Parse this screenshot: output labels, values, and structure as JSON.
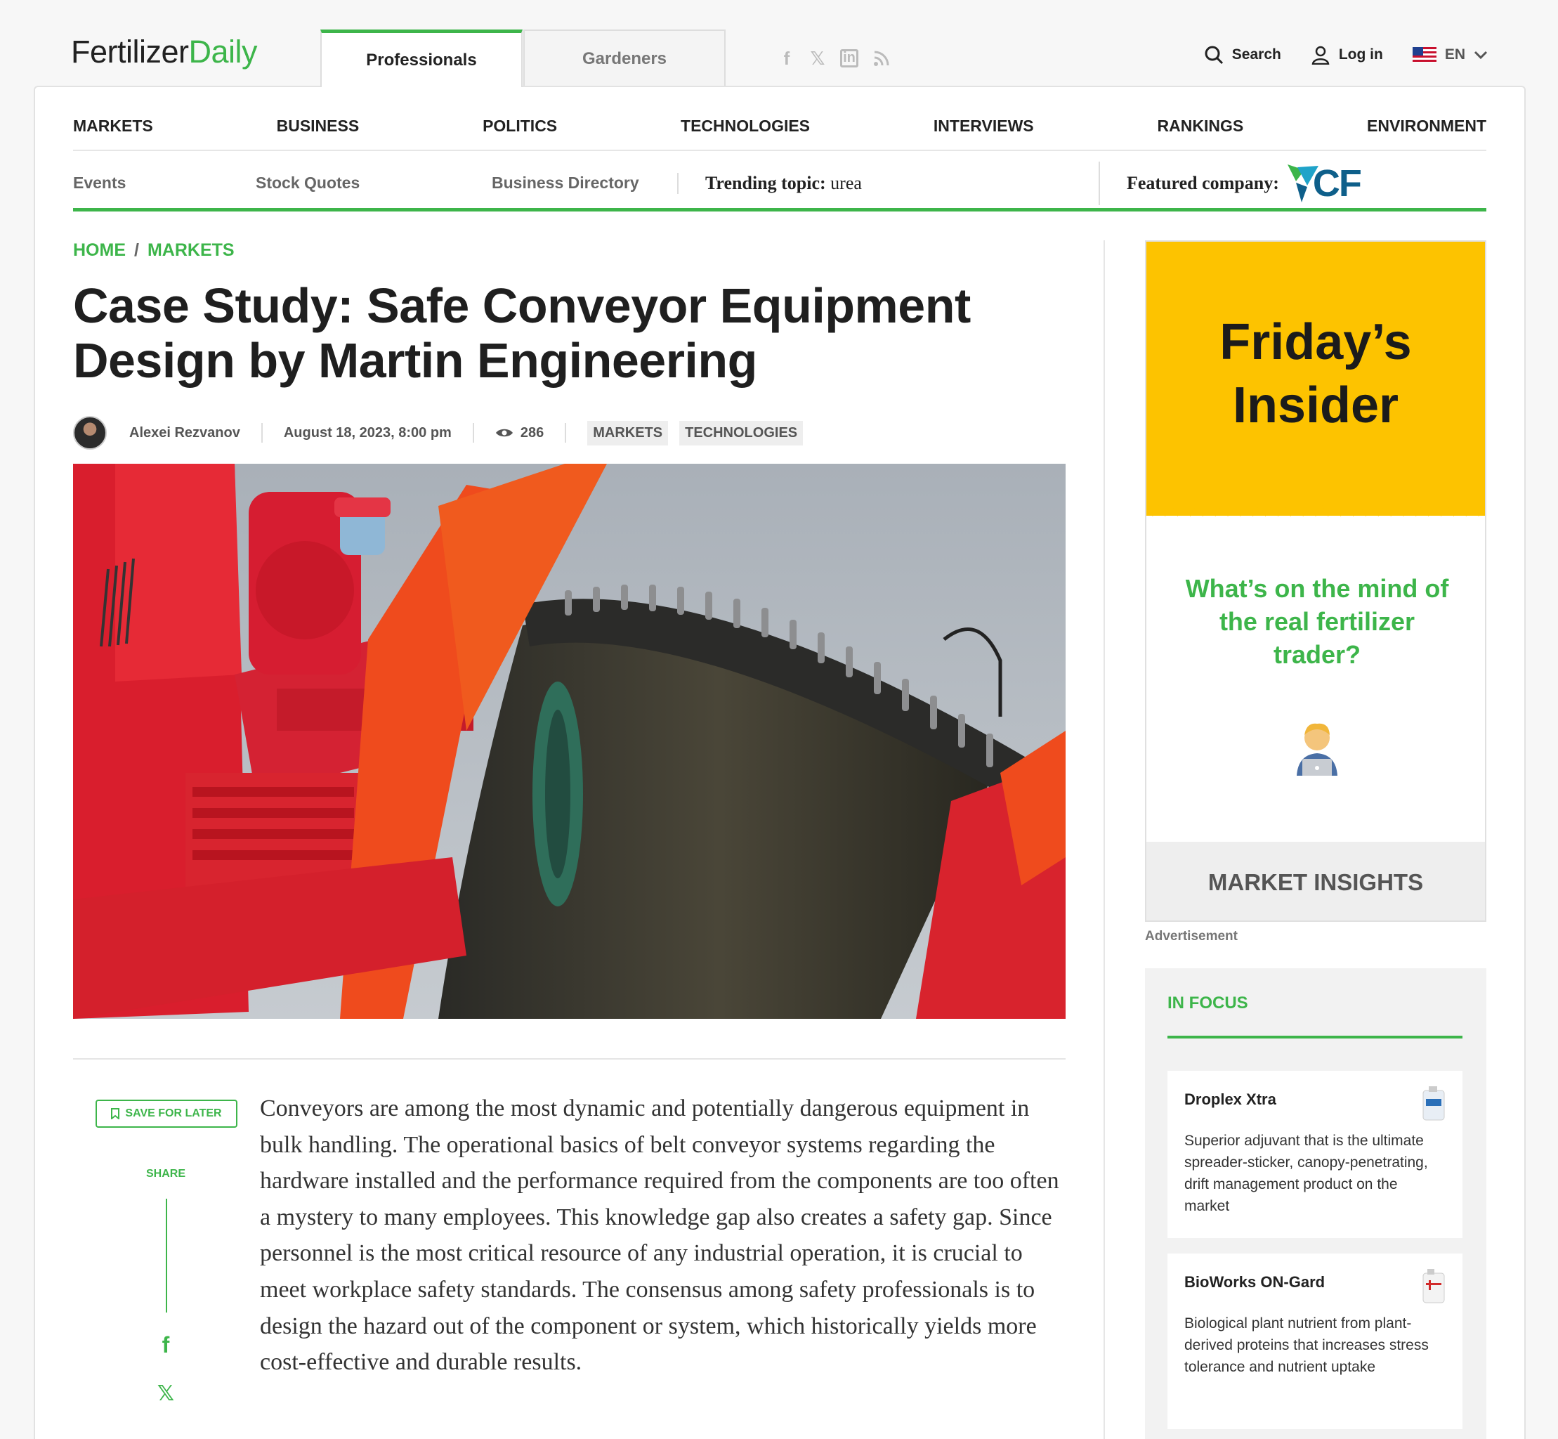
{
  "header": {
    "logo_part1": "Fertilizer",
    "logo_part2": "Daily",
    "tabs": [
      {
        "label": "Professionals",
        "active": true
      },
      {
        "label": "Gardeners",
        "active": false
      }
    ],
    "social_icons": [
      "facebook-icon",
      "x-icon",
      "linkedin-icon",
      "rss-icon"
    ],
    "search_label": "Search",
    "login_label": "Log in",
    "language": "EN"
  },
  "main_nav": [
    "MARKETS",
    "BUSINESS",
    "POLITICS",
    "TECHNOLOGIES",
    "INTERVIEWS",
    "RANKINGS",
    "ENVIRONMENT"
  ],
  "sub_nav": {
    "links": [
      "Events",
      "Stock Quotes",
      "Business Directory"
    ],
    "trending_label": "Trending topic:",
    "trending_value": "urea",
    "featured_label": "Featured company:",
    "featured_company": "CF"
  },
  "breadcrumb": {
    "home": "HOME",
    "separator": "/",
    "current": "MARKETS"
  },
  "article": {
    "title": "Case Study: Safe Conveyor Equipment Design by Martin Engineering",
    "author": "Alexei Rezvanov",
    "date": "August 18, 2023, 8:00 pm",
    "views": "286",
    "tags": [
      "MARKETS",
      "TECHNOLOGIES"
    ],
    "save_label": "SAVE FOR LATER",
    "share_label": "SHARE",
    "body": "Conveyors are among the most dynamic and potentially dangerous equipment in bulk handling. The operational basics of belt conveyor systems regarding the hardware installed and the performance required from the components are too often a mystery to many employees. This knowledge gap also creates a safety gap. Since personnel is the most critical resource of any industrial operation, it is crucial to meet workplace safety standards. The consensus among safety professionals is to design the hazard out of the component or system, which historically yields more cost-effective and durable results."
  },
  "ad": {
    "headline_line1": "Friday’s",
    "headline_line2": "Insider",
    "question": "What’s on the mind of the real fertilizer trader?",
    "footer": "MARKET INSIGHTS",
    "label": "Advertisement"
  },
  "in_focus": {
    "heading": "IN FOCUS",
    "items": [
      {
        "name": "Droplex Xtra",
        "description": "Superior adjuvant that is the ultimate spreader-sticker, canopy-penetrating, drift management product on the market"
      },
      {
        "name": "BioWorks ON-Gard",
        "description": "Biological plant nutrient from plant-derived proteins that increases stress tolerance and nutrient uptake"
      }
    ]
  },
  "colors": {
    "brand_green": "#3db54a",
    "ad_yellow": "#fdc300",
    "cf_blue": "#0e5f8a"
  }
}
